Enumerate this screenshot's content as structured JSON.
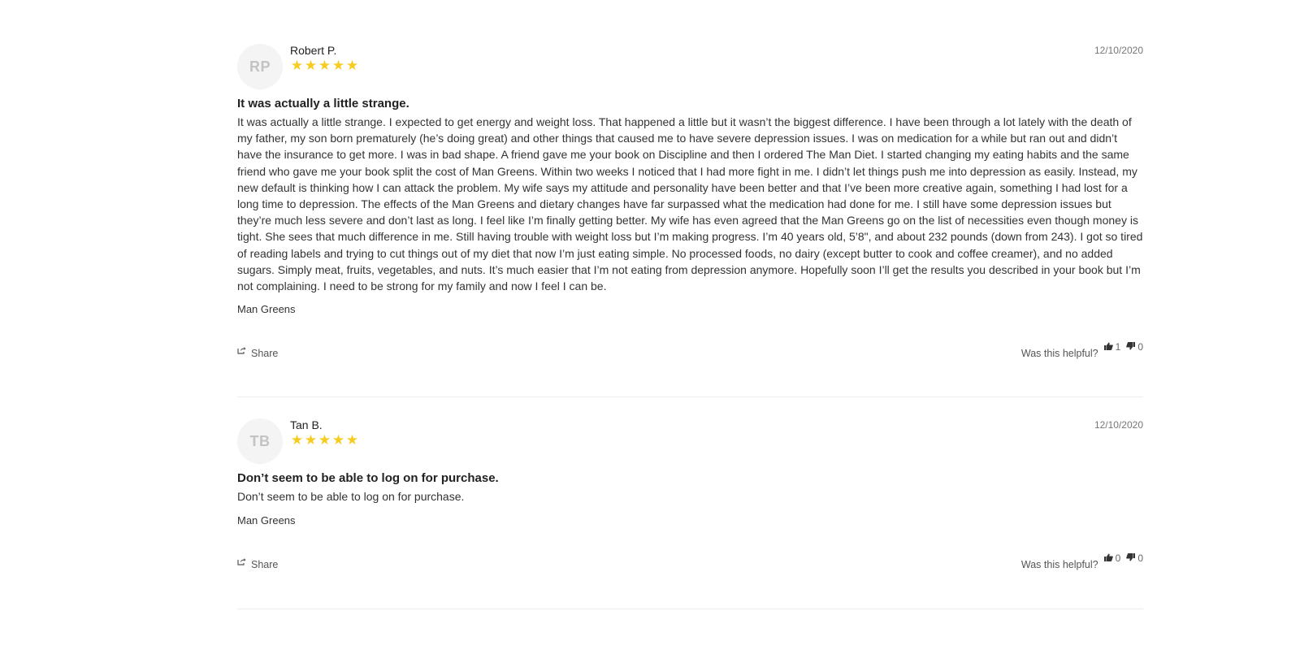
{
  "reviews": [
    {
      "initials": "RP",
      "author": "Robert P.",
      "stars": [
        "★",
        "★",
        "★",
        "★",
        "★"
      ],
      "rating": 5,
      "date": "12/10/2020",
      "title": "It was actually a little strange.",
      "body": "It was actually a little strange. I expected to get energy and weight loss. That happened a little but it wasn’t the biggest difference. I have been through a lot lately with the death of my father, my son born prematurely (he’s doing great) and other things that caused me to have severe depression issues. I was on medication for a while but ran out and didn’t have the insurance to get more. I was in bad shape. A friend gave me your book on Discipline and then I ordered The Man Diet. I started changing my eating habits and the same friend who gave me your book split the cost of Man Greens. Within two weeks I noticed that I had more fight in me. I didn’t let things push me into depression as easily. Instead, my new default is thinking how I can attack the problem. My wife says my attitude and personality have been better and that I’ve been more creative again, something I had lost for a long time to depression. The effects of the Man Greens and dietary changes have far surpassed what the medication had done for me. I still have some depression issues but they’re much less severe and don’t last as long. I feel like I’m finally getting better. My wife has even agreed that the Man Greens go on the list of necessities even though money is tight. She sees that much difference in me. Still having trouble with weight loss but I’m making progress. I’m 40 years old, 5’8\", and about 232 pounds (down from 243). I got so tired of reading labels and trying to cut things out of my diet that now I’m just eating simple. No processed foods, no dairy (except butter to cook and coffee creamer), and no added sugars. Simply meat, fruits, vegetables, and nuts. It’s much easier that I’m not eating from depression anymore. Hopefully soon I’ll get the results you described in your book but I’m not complaining. I need to be strong for my family and now I feel I can be.",
      "product": "Man Greens",
      "share_label": "Share",
      "helpful_label": "Was this helpful?",
      "up_count": "1",
      "down_count": "0"
    },
    {
      "initials": "TB",
      "author": "Tan B.",
      "stars": [
        "★",
        "★",
        "★",
        "★",
        "★"
      ],
      "rating": 5,
      "date": "12/10/2020",
      "title": "Don’t seem to be able to log on for purchase.",
      "body": "Don’t seem to be able to log on for purchase.",
      "product": "Man Greens",
      "share_label": "Share",
      "helpful_label": "Was this helpful?",
      "up_count": "0",
      "down_count": "0"
    }
  ],
  "colors": {
    "star": "#f7cc1f",
    "avatar_bg": "#f4f4f4",
    "avatar_text": "#c3c3c3",
    "divider": "#eeeeee"
  },
  "icons": {
    "share": "share-icon",
    "thumbs_up": "thumbs-up-icon",
    "thumbs_down": "thumbs-down-icon"
  }
}
